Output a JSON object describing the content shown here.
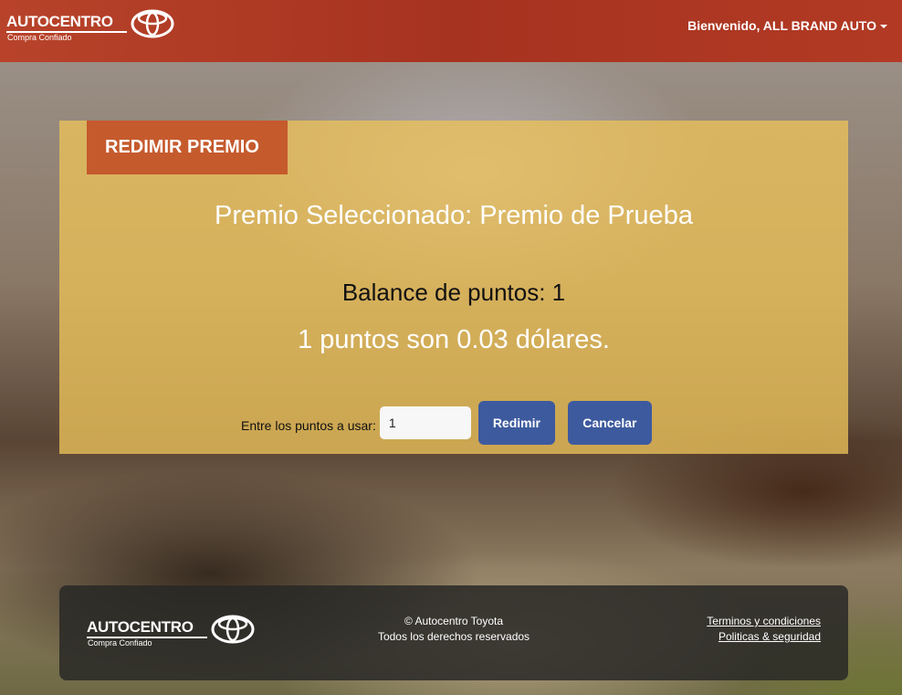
{
  "header": {
    "logo_text": "AUTOCENTRO",
    "logo_sub": "Compra Confiado",
    "user_greeting": "Bienvenido, ALL BRAND AUTO"
  },
  "panel": {
    "tab_title": "REDIMIR PREMIO",
    "prize_title": "Premio Seleccionado: Premio de Prueba",
    "balance": "Balance de puntos: 1",
    "conversion": "1 puntos son 0.03 dólares.",
    "points_label": "Entre los puntos a usar:",
    "points_value": "1",
    "redeem_label": "Redimir",
    "cancel_label": "Cancelar"
  },
  "footer": {
    "logo_text": "AUTOCENTRO",
    "logo_sub": "Compra Confiado",
    "copyright": "© Autocentro Toyota",
    "rights": "Todos los derechos reservados",
    "terms_link": "Terminos y condiciones",
    "privacy_link": "Politicas & seguridad"
  },
  "colors": {
    "header_red": "#a63320",
    "tab_orange": "#c55a2d",
    "panel_gold": "#ecc25a",
    "button_blue": "#3d5a9e"
  }
}
